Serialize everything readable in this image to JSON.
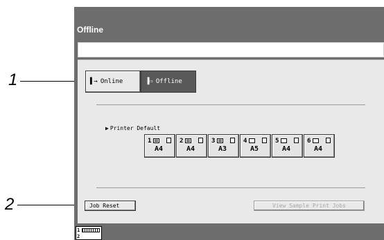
{
  "callouts": [
    "1",
    "2"
  ],
  "window": {
    "title": "Offline",
    "message": ""
  },
  "mode_buttons": {
    "online_label": "Online",
    "offline_label": "Offline",
    "selected": "offline"
  },
  "printer_default": {
    "label": "Printer Default",
    "trays": [
      {
        "number": "1",
        "size": "A4",
        "paper": "filled"
      },
      {
        "number": "2",
        "size": "A4",
        "paper": "filled"
      },
      {
        "number": "3",
        "size": "A3",
        "paper": "filled"
      },
      {
        "number": "4",
        "size": "A5",
        "paper": "empty"
      },
      {
        "number": "5",
        "size": "A4",
        "paper": "empty"
      },
      {
        "number": "6",
        "size": "A4",
        "paper": "empty"
      }
    ]
  },
  "actions": {
    "job_reset_label": "Job Reset",
    "view_jobs_label": "View Sample Print Jobs"
  },
  "footer": {
    "tray1": "1",
    "tray2": "2"
  },
  "colors": {
    "panel": "#6d6d6d",
    "screen": "#e9e9e9",
    "selected": "#595959"
  }
}
